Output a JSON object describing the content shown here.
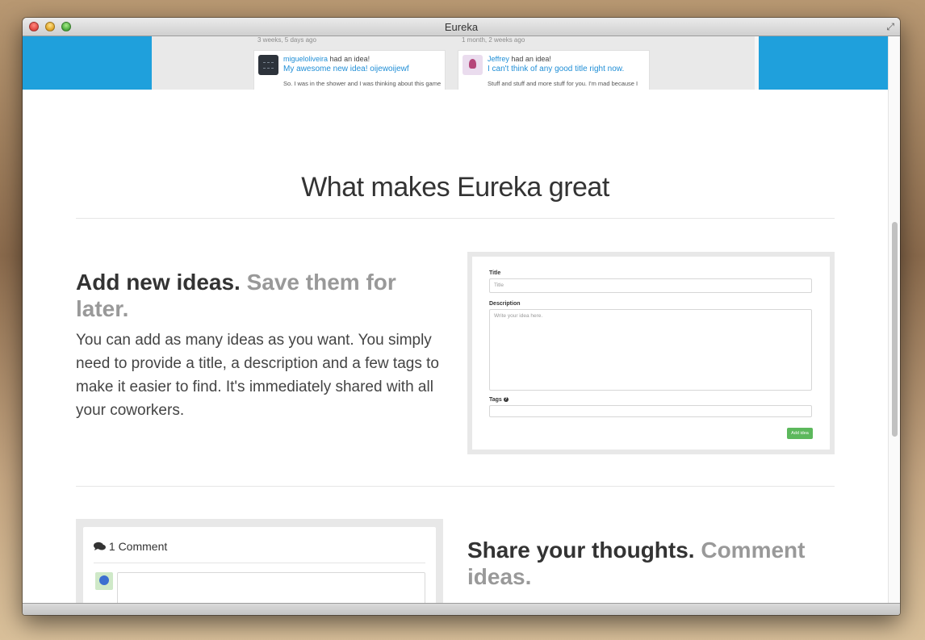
{
  "window": {
    "title": "Eureka"
  },
  "hero": {
    "feed": [
      {
        "time": "3 weeks, 5 days ago",
        "user": "migueloliveira",
        "action": "had an idea!",
        "title": "My awesome new idea! oijewoijewf",
        "snippet": "So. I was in the shower and I was thinking about this game"
      },
      {
        "time": "1 month, 2 weeks ago",
        "user": "Jeffrey",
        "action": "had an idea!",
        "title": "I can't think of any good title right now.",
        "snippet": "Stuff and stuff and more stuff for you. I'm mad because I"
      }
    ]
  },
  "section": {
    "title": "What makes Eureka great"
  },
  "features": {
    "add": {
      "heading_strong": "Add new ideas.",
      "heading_muted": "Save them for later.",
      "text": "You can add as many ideas as you want. You simply need to provide a title, a description and a few tags to make it easier to find. It's immediately shared with all your coworkers."
    },
    "share": {
      "heading_strong": "Share your thoughts.",
      "heading_muted": "Comment ideas."
    }
  },
  "form": {
    "title_label": "Title",
    "title_placeholder": "Title",
    "description_label": "Description",
    "description_placeholder": "Write your idea here.",
    "tags_label": "Tags",
    "submit_label": "Add idea"
  },
  "comments": {
    "count_label": "1 Comment"
  }
}
